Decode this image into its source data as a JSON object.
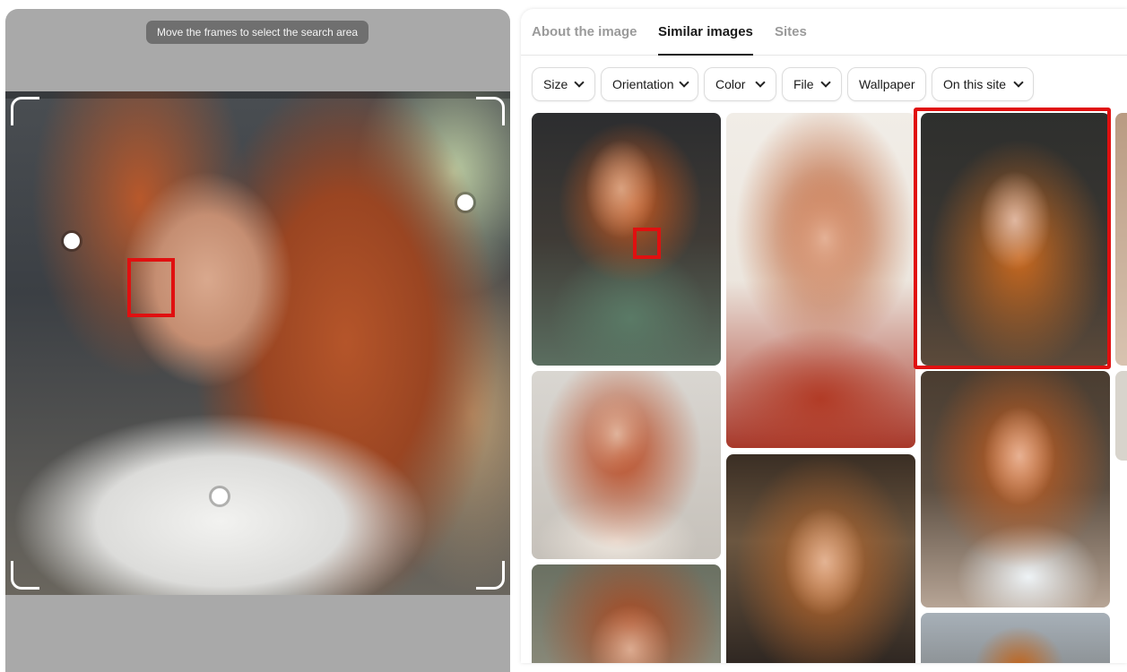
{
  "selector": {
    "hint": "Move the frames to select the search area"
  },
  "tabs": [
    {
      "label": "About the image",
      "active": false
    },
    {
      "label": "Similar images",
      "active": true
    },
    {
      "label": "Sites",
      "active": false
    }
  ],
  "filters": [
    {
      "label": "Size",
      "dropdown": true
    },
    {
      "label": "Orientation",
      "dropdown": true
    },
    {
      "label": "Color",
      "dropdown": true
    },
    {
      "label": "File",
      "dropdown": true
    },
    {
      "label": "Wallpaper",
      "dropdown": false
    },
    {
      "label": "On this site",
      "dropdown": true
    }
  ],
  "colors": {
    "highlight": "#e01010",
    "active_tab": "#1a1a1a",
    "inactive_tab": "#9a9a9a"
  }
}
